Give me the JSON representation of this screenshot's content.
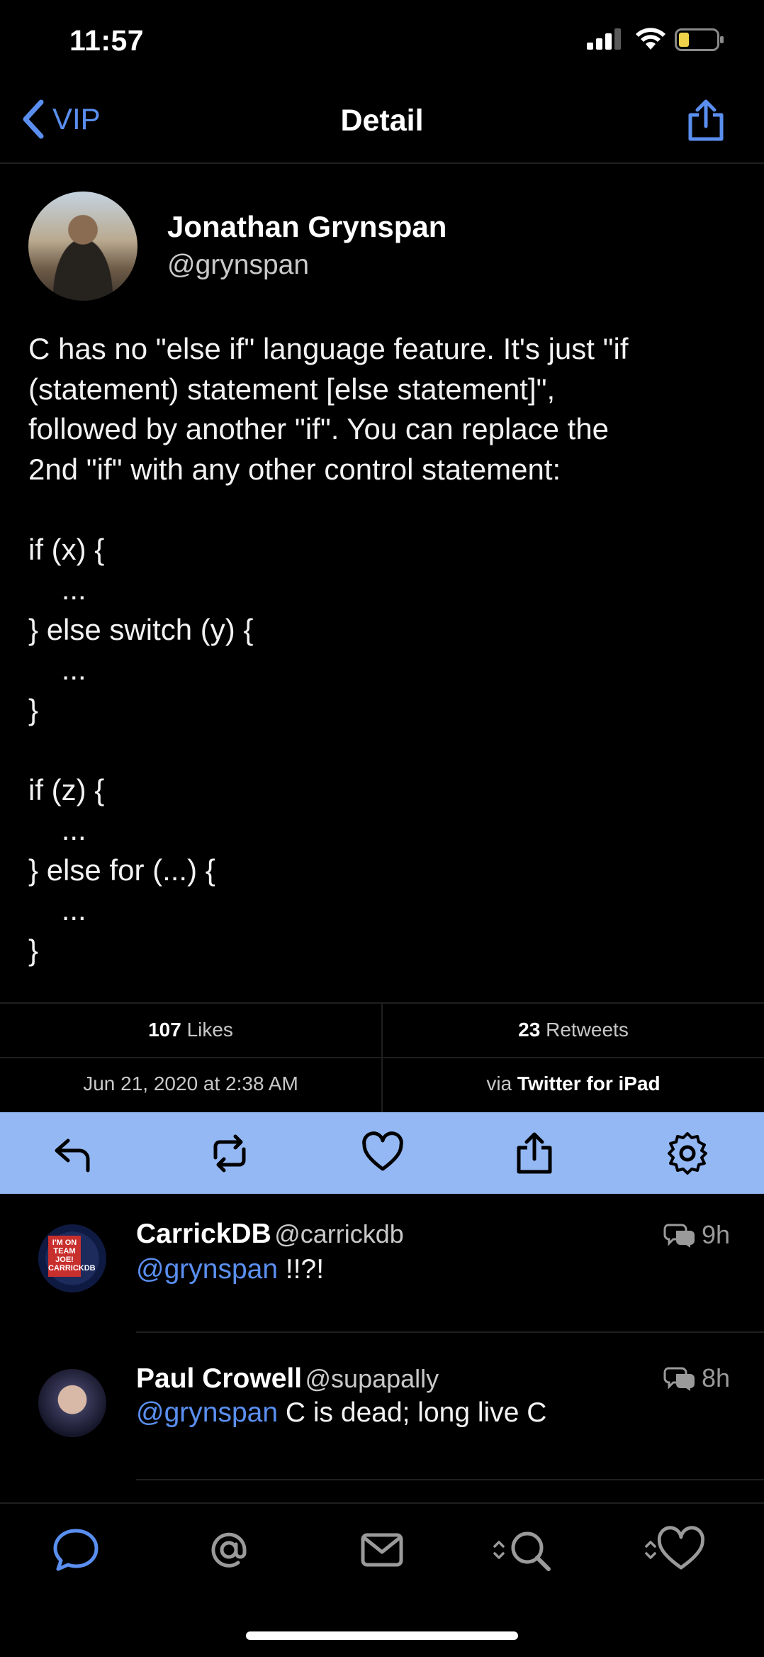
{
  "status": {
    "time": "11:57"
  },
  "nav": {
    "back_label": "VIP",
    "title": "Detail"
  },
  "tweet": {
    "author_name": "Jonathan Grynspan",
    "author_handle": "@grynspan",
    "text": "C has no \"else if\" language feature. It's just \"if\n(statement) statement [else statement]\",\nfollowed by another \"if\". You can replace the\n2nd \"if\" with any other control statement:\n\nif (x) {\n    ...\n} else switch (y) {\n    ...\n}\n\nif (z) {\n    ...\n} else for (...) {\n    ...\n}",
    "likes_count": "107",
    "likes_label": "Likes",
    "retweets_count": "23",
    "retweets_label": "Retweets",
    "date": "Jun 21, 2020 at 2:38 AM",
    "via_prefix": "via",
    "via_client": "Twitter for iPad"
  },
  "actions": {
    "icons": [
      "reply-icon",
      "retweet-icon",
      "like-icon",
      "share-icon",
      "settings-icon"
    ],
    "color": "#94b8f4"
  },
  "replies": [
    {
      "name": "CarrickDB",
      "handle": "@carrickdb",
      "mention": "@grynspan",
      "text": "!!?!",
      "time": "9h",
      "avatar_text": "I'M ON TEAM JOE! CARRICKDB"
    },
    {
      "name": "Paul Crowell",
      "handle": "@supapally",
      "mention": "@grynspan",
      "text": "C is dead; long live C",
      "time": "8h"
    }
  ],
  "tabs": [
    "timeline-icon",
    "mentions-icon",
    "messages-icon",
    "search-icon",
    "favorites-icon"
  ],
  "colors": {
    "accent": "#5a8ff0",
    "background": "#000000"
  }
}
